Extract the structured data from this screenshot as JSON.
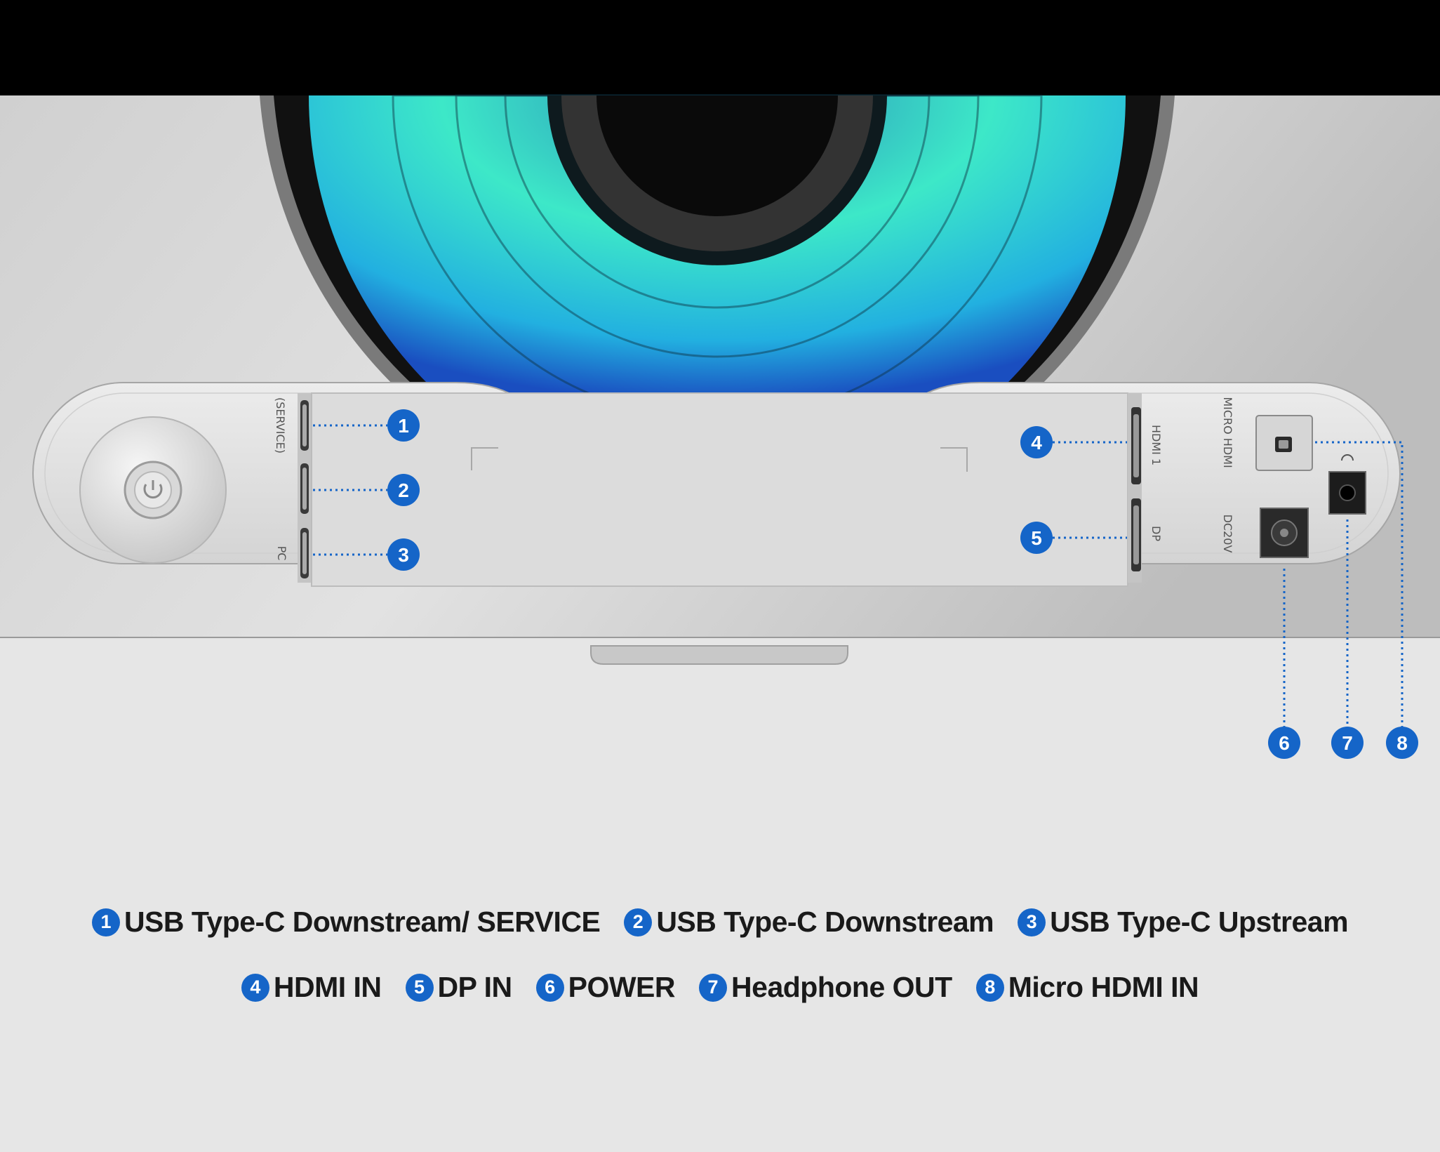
{
  "colors": {
    "marker": "#1565c8",
    "marker_text": "#ffffff",
    "legend_text": "#1a1a1a",
    "background": "#e6e6e6",
    "top_band": "#000000",
    "ring_glow": "#3de8c8"
  },
  "port_labels": {
    "usb_c_service": "(SERVICE)",
    "pc": "PC",
    "hdmi": "HDMI 1",
    "dp": "DP",
    "micro_hdmi": "MICRO HDMI",
    "dc": "DC20V"
  },
  "markers": [
    "1",
    "2",
    "3",
    "4",
    "5",
    "6",
    "7",
    "8"
  ],
  "legend": {
    "row1": [
      {
        "num": "1",
        "label": "USB Type-C Downstream/ SERVICE"
      },
      {
        "num": "2",
        "label": "USB Type-C Downstream"
      },
      {
        "num": "3",
        "label": "USB Type-C Upstream"
      }
    ],
    "row2": [
      {
        "num": "4",
        "label": "HDMI IN"
      },
      {
        "num": "5",
        "label": "DP IN"
      },
      {
        "num": "6",
        "label": "POWER"
      },
      {
        "num": "7",
        "label": "Headphone OUT"
      },
      {
        "num": "8",
        "label": "Micro HDMI IN"
      }
    ]
  }
}
